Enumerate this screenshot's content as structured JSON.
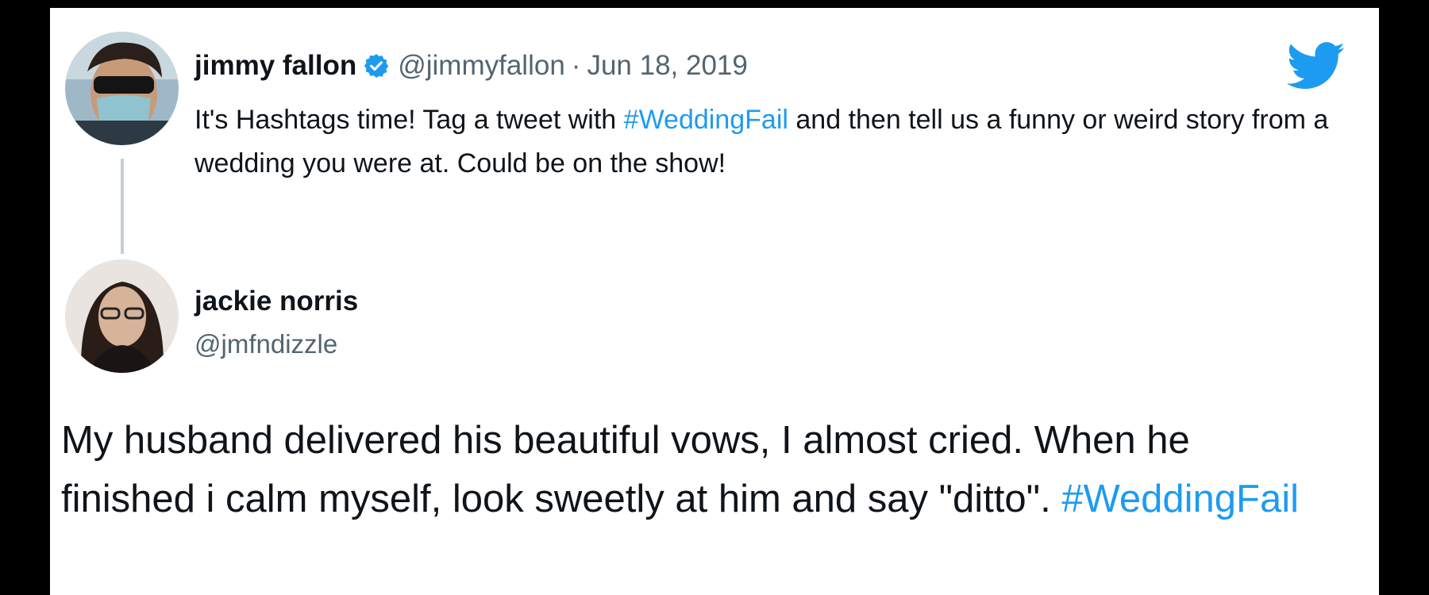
{
  "colors": {
    "accent": "#1d9bf0",
    "text": "#0f1419",
    "muted": "#536471",
    "thread_line": "#c4cfd6"
  },
  "original_tweet": {
    "author_name": "jimmy fallon",
    "verified_icon": "verified-badge-icon",
    "handle": "@jimmyfallon",
    "separator": "·",
    "date": "Jun 18, 2019",
    "text_before": "It's Hashtags time! Tag a tweet with ",
    "hashtag": "#WeddingFail",
    "text_after": " and then tell us a funny or weird story from a wedding you were at. Could be on the show!",
    "logo_icon": "twitter-bird-icon"
  },
  "reply_tweet": {
    "author_name": "jackie norris",
    "handle": "@jmfndizzle",
    "text": "My husband delivered his beautiful vows, I almost cried. When he finished i calm myself, look sweetly at him and say \"ditto\". ",
    "hashtag": "#WeddingFail"
  }
}
